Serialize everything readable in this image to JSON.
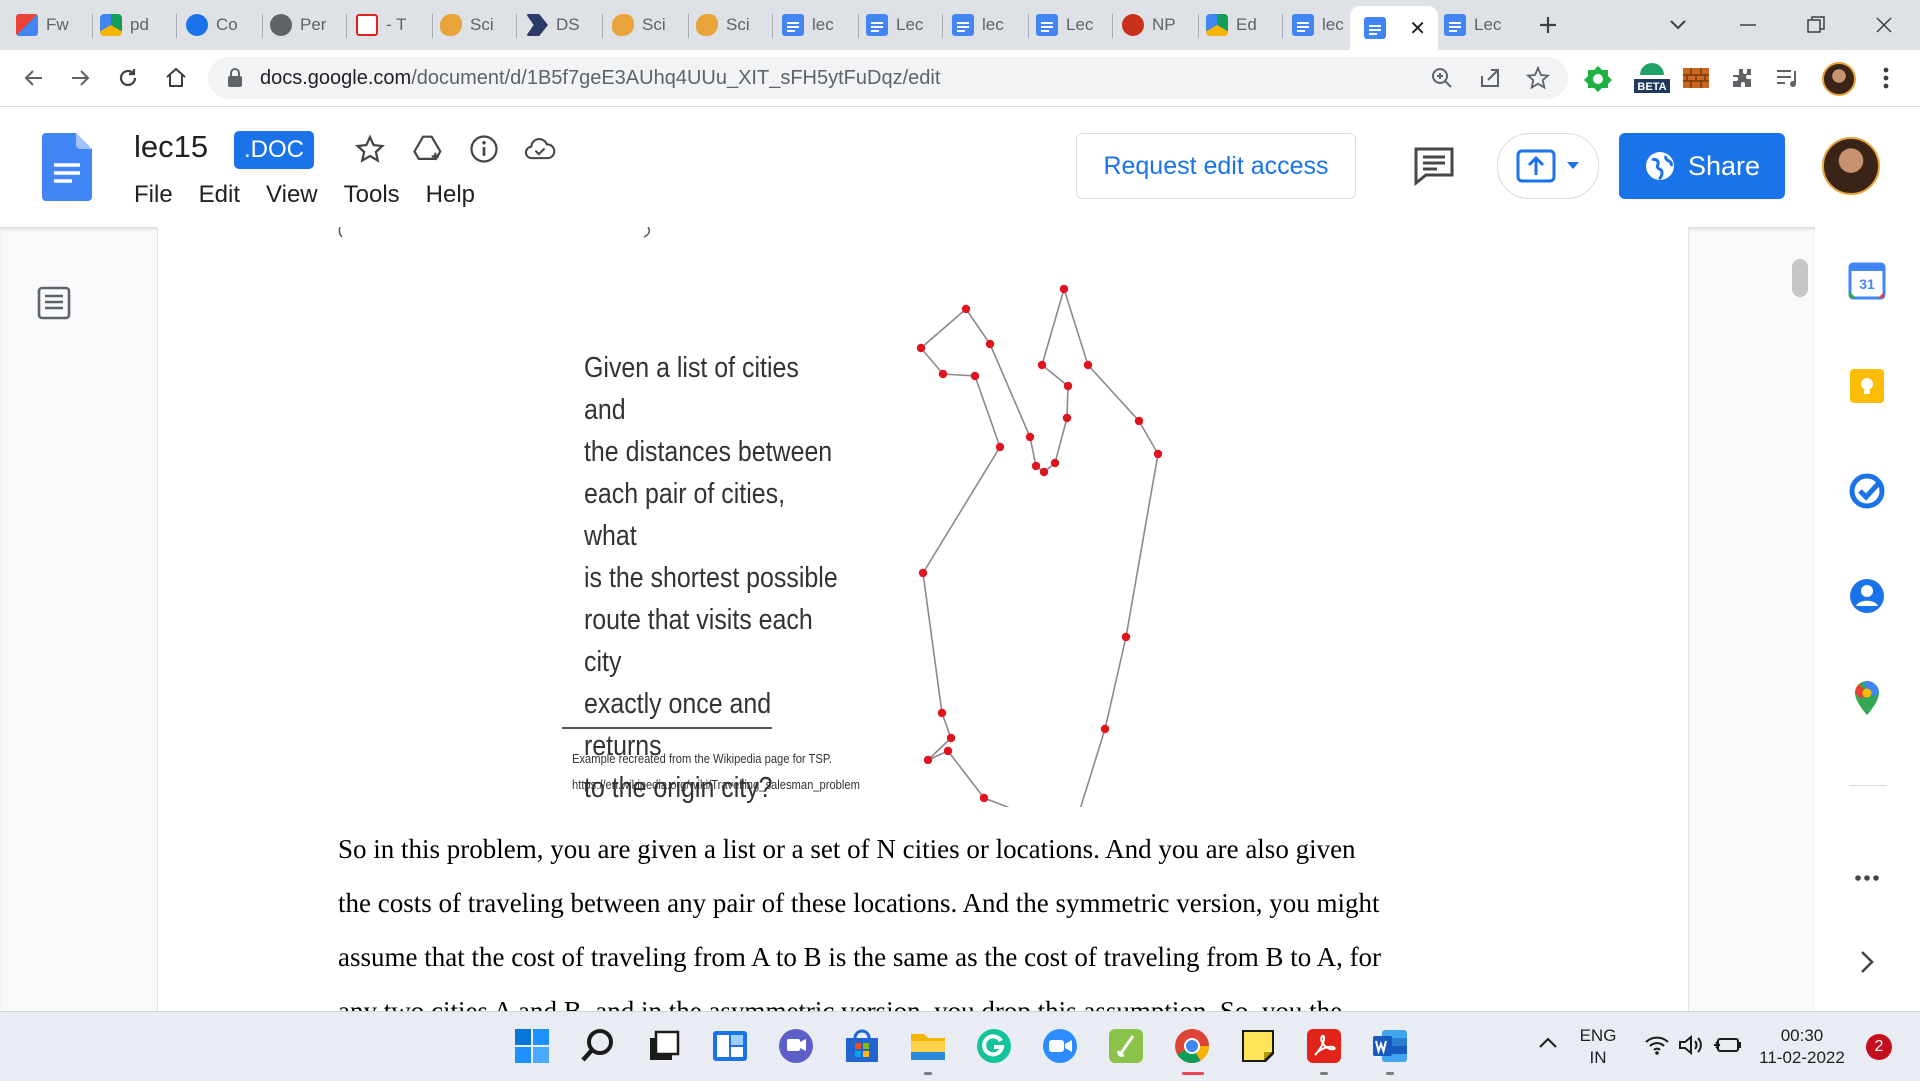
{
  "tabs": [
    {
      "label": "Fw",
      "icon": "gmail-icon"
    },
    {
      "label": "pd",
      "icon": "google-drive-icon"
    },
    {
      "label": "Co",
      "icon": "link-icon"
    },
    {
      "label": "Per",
      "icon": "perplexity-icon"
    },
    {
      "label": "- T",
      "icon": "acrobat-icon"
    },
    {
      "label": "Sci",
      "icon": "scilab-icon"
    },
    {
      "label": "DS",
      "icon": "arrow-app-icon"
    },
    {
      "label": "Sci",
      "icon": "scilab-icon"
    },
    {
      "label": "Sci",
      "icon": "scilab-icon"
    },
    {
      "label": "lec",
      "icon": "docs-icon"
    },
    {
      "label": "Lec",
      "icon": "docs-icon"
    },
    {
      "label": "lec",
      "icon": "docs-icon"
    },
    {
      "label": "Lec",
      "icon": "docs-icon"
    },
    {
      "label": "NP",
      "icon": "nptel-icon"
    },
    {
      "label": "Ed",
      "icon": "google-drive-icon"
    },
    {
      "label": "lec",
      "icon": "docs-icon"
    },
    {
      "label": "",
      "icon": "docs-icon",
      "active": true
    },
    {
      "label": "Lec",
      "icon": "docs-icon"
    }
  ],
  "address_bar": {
    "host": "docs.google.com",
    "path": "/document/d/1B5f7geE3AUhq4UUu_XIT_sFH5ytFuDqz/edit"
  },
  "extensions": {
    "beta_badge": "BETA"
  },
  "doc": {
    "title": "lec15",
    "badge": ".DOC",
    "menu": [
      "File",
      "Edit",
      "View",
      "Tools",
      "Help"
    ],
    "request_edit": "Request edit access",
    "share": "Share"
  },
  "figure": {
    "caption_lines": [
      "Given a list of cities and",
      "the distances between",
      "each pair of cities, what",
      "is the shortest possible",
      "route that visits each city",
      "exactly once and returns",
      "to the origin city?"
    ],
    "source_lines": [
      "Example recreated from the Wikipedia page for TSP.",
      "https://en.wikipedia.org/wiki/Travelling_salesman_problem"
    ],
    "route_color": "#8a8a8a",
    "city_color": "#e0141e"
  },
  "body_text": [
    "So in this problem, you are given a list or a set of N cities or locations. And you are also given",
    "the costs of traveling between any pair of these locations. And the symmetric version, you might",
    "assume that the cost of traveling from A to B is the same as the cost of traveling from B to A, for",
    "any two cities A and B, and in the asymmetric version, you drop this assumption. So, you the"
  ],
  "taskbar": {
    "lang_top": "ENG",
    "lang_bottom": "IN",
    "time": "00:30",
    "date": "11-02-2022",
    "notifications": "2"
  },
  "colors": {
    "accent": "#1a73e8",
    "docs_blue": "#4285f4"
  }
}
